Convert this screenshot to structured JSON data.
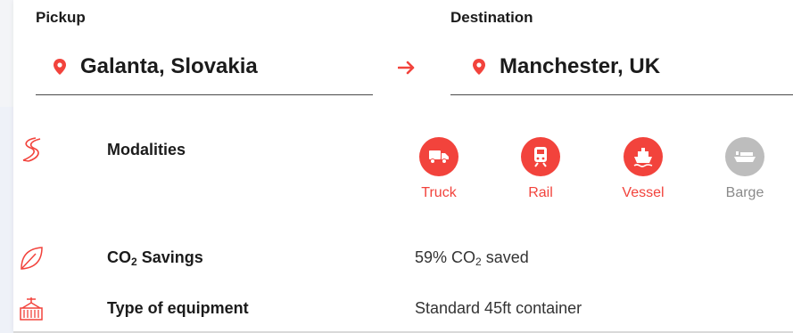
{
  "header": {
    "pickup_label": "Pickup",
    "pickup_value": "Galanta, Slovakia",
    "destination_label": "Destination",
    "destination_value": "Manchester, UK"
  },
  "rows": {
    "modalities": {
      "label": "Modalities",
      "icon": "route-icon"
    },
    "co2": {
      "label_prefix": "CO",
      "label_sub": "2",
      "label_suffix": " Savings",
      "value_prefix": "59% CO",
      "value_sub": "2",
      "value_suffix": " saved",
      "icon": "leaf-icon"
    },
    "equipment": {
      "label": "Type of equipment",
      "value": "Standard 45ft container",
      "icon": "container-crane-icon"
    }
  },
  "modalities": [
    {
      "label": "Truck",
      "icon": "truck-icon",
      "active": true
    },
    {
      "label": "Rail",
      "icon": "train-icon",
      "active": true
    },
    {
      "label": "Vessel",
      "icon": "ship-icon",
      "active": true
    },
    {
      "label": "Barge",
      "icon": "barge-icon",
      "active": false
    }
  ],
  "colors": {
    "accent": "#f2433c",
    "inactive": "#bdbdbd",
    "inactive_text": "#8a8a8a"
  }
}
